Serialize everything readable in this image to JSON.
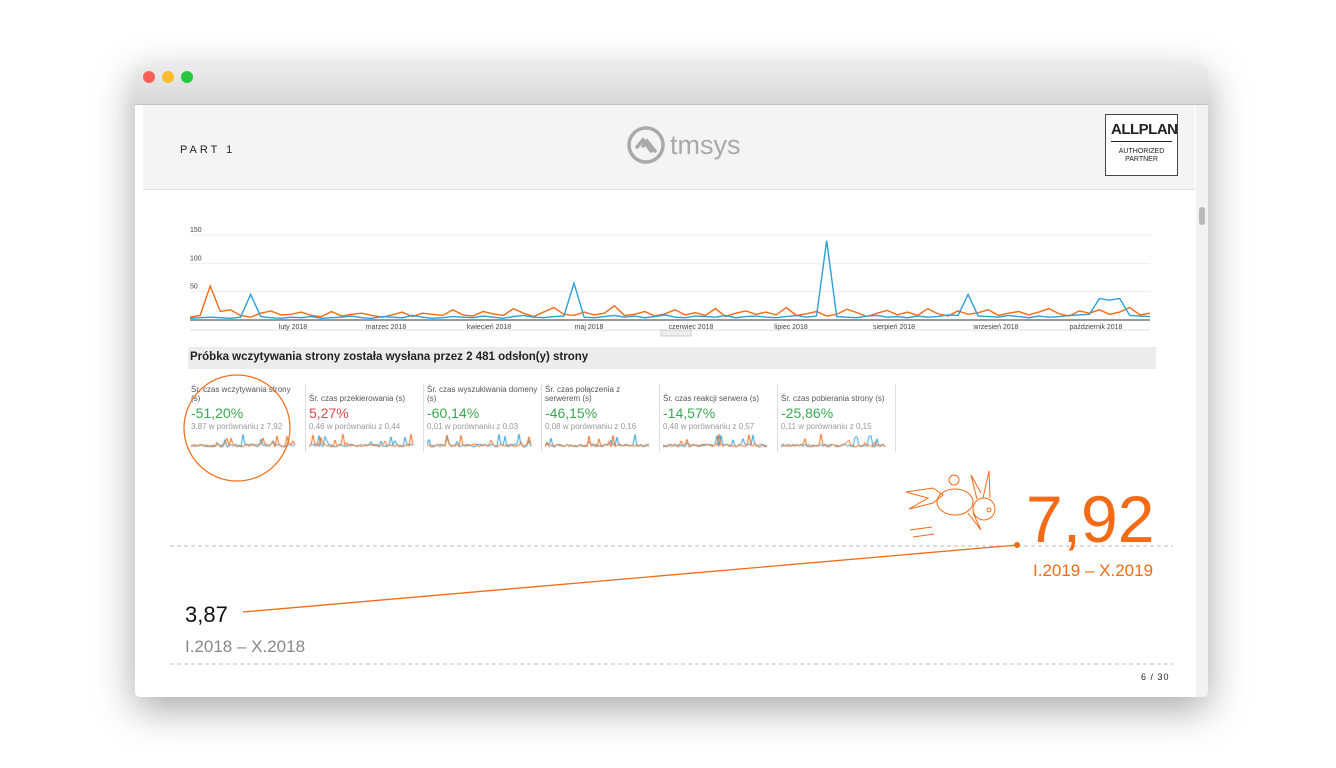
{
  "header": {
    "part": "PART 1",
    "logo_text": "tmsys",
    "partner_logo": "ALLPLAN",
    "partner_sub1": "AUTHORIZED",
    "partner_sub2": "PARTNER"
  },
  "summary": "Próbka wczytywania strony została wysłana przez 2 481 odsłon(y) strony",
  "colors": {
    "orange": "#f36b16",
    "blue": "#2a9fd8",
    "green": "#3aa650",
    "red": "#e2474b"
  },
  "chart_data": {
    "type": "line",
    "yticks": [
      50,
      100,
      150
    ],
    "ylim": [
      0,
      150
    ],
    "month_labels": [
      "luty 2018",
      "marzec 2018",
      "kwiecień 2018",
      "maj 2018",
      "czerwiec 2018",
      "lipiec 2018",
      "sierpień 2018",
      "wrzesień 2018",
      "październik 2018"
    ],
    "series": [
      {
        "name": "orange",
        "color": "#f36b16",
        "values": [
          5,
          8,
          60,
          15,
          18,
          8,
          5,
          12,
          16,
          9,
          10,
          14,
          8,
          6,
          15,
          7,
          10,
          12,
          8,
          5,
          9,
          14,
          6,
          12,
          10,
          8,
          18,
          9,
          7,
          15,
          11,
          8,
          20,
          12,
          6,
          14,
          22,
          10,
          8,
          14,
          9,
          12,
          25,
          8,
          10,
          15,
          7,
          11,
          18,
          9,
          13,
          8,
          20,
          6,
          12,
          16,
          10,
          14,
          9,
          22,
          8,
          11,
          15,
          7,
          10,
          19,
          13,
          6,
          12,
          17,
          9,
          14,
          8,
          20,
          11,
          7,
          16,
          10,
          13,
          18,
          8,
          12,
          15,
          9,
          14,
          20,
          11,
          7,
          16,
          12,
          18,
          10,
          14,
          22,
          9,
          12
        ]
      },
      {
        "name": "blue",
        "color": "#2a9fd8",
        "values": [
          3,
          4,
          5,
          4,
          3,
          5,
          45,
          6,
          4,
          3,
          5,
          4,
          6,
          3,
          4,
          5,
          7,
          4,
          3,
          6,
          5,
          4,
          8,
          5,
          3,
          4,
          6,
          5,
          4,
          7,
          5,
          3,
          6,
          8,
          5,
          4,
          6,
          7,
          65,
          5,
          4,
          6,
          8,
          5,
          7,
          4,
          6,
          9,
          5,
          4,
          7,
          6,
          5,
          8,
          4,
          6,
          7,
          5,
          4,
          6,
          8,
          5,
          7,
          140,
          6,
          5,
          4,
          7,
          8,
          5,
          6,
          4,
          7,
          5,
          6,
          9,
          8,
          45,
          7,
          6,
          5,
          8,
          6,
          4,
          7,
          5,
          6,
          8,
          9,
          10,
          38,
          35,
          38,
          8,
          7,
          6
        ]
      }
    ]
  },
  "cards": [
    {
      "label": "Śr. czas wczytywania strony (s)",
      "value": "-51,20%",
      "compare": "3,87 w porównaniu z 7,92",
      "trend": "good"
    },
    {
      "label": "Śr. czas przekierowania (s)",
      "value": "5,27%",
      "compare": "0,46 w porównaniu z 0,44",
      "trend": "bad"
    },
    {
      "label": "Śr. czas wyszukiwania domeny (s)",
      "value": "-60,14%",
      "compare": "0,01 w porównaniu z 0,03",
      "trend": "good"
    },
    {
      "label": "Śr. czas połączenia z serwerem (s)",
      "value": "-46,15%",
      "compare": "0,08 w porównaniu z 0,16",
      "trend": "good"
    },
    {
      "label": "Śr. czas reakcji serwera (s)",
      "value": "-14,57%",
      "compare": "0,48 w porównaniu z 0,57",
      "trend": "good"
    },
    {
      "label": "Śr. czas pobierania strony (s)",
      "value": "-25,86%",
      "compare": "0,11 w porównaniu z 0,15",
      "trend": "good"
    }
  ],
  "comparison": {
    "old_value": "3,87",
    "old_period": "I.2018 – X.2018",
    "new_value": "7,92",
    "new_period": "I.2019 – X.2019"
  },
  "page_number": "6 / 30"
}
